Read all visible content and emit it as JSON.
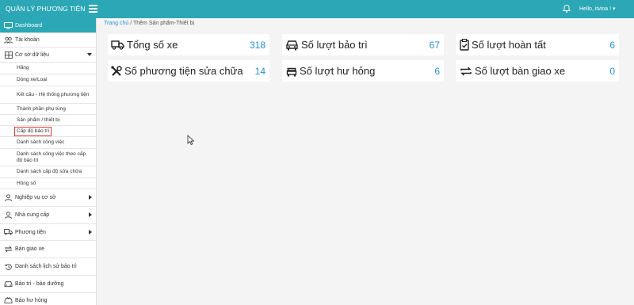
{
  "header": {
    "brand": "QUẢN LÝ PHƯƠNG TIỆN",
    "user_greeting": "Hello, itvina !",
    "user_caret": "▾"
  },
  "sidebar": {
    "dashboard": "Dashboard",
    "account": "Tài khoản",
    "database": "Cơ sở dữ liệu",
    "database_items": [
      "Hãng",
      "Dòng xe/Loại",
      "Kết cấu - Hệ thống phương tiện",
      "Thành phần phụ tùng",
      "Sản phẩm / thiết bị",
      "Cấp độ bảo trì",
      "Danh sách công việc",
      "Danh sách công việc theo cấp độ bảo trì",
      "Danh sách cấp độ sửa chữa",
      "Hồng số"
    ],
    "business": "Nghiệp vụ cơ sở",
    "supplier": "Nhà cung cấp",
    "vehicle": "Phương tiện",
    "handover": "Bàn giao xe",
    "history": "Danh sách lịch sử bảo trì",
    "maintenance": "Bảo trì - bảo dưỡng",
    "damage": "Báo hư hỏng"
  },
  "breadcrumb": {
    "home": "Trang chủ",
    "separator": "/",
    "current": "Thêm Sản phẩm-Thiết bị"
  },
  "cards": [
    {
      "icon": "truck-icon",
      "label": "Tổng số xe",
      "value": "318"
    },
    {
      "icon": "car-icon",
      "label": "Số lượt bảo trì",
      "value": "67"
    },
    {
      "icon": "clipboard-check-icon",
      "label": "Số lượt hoàn tất",
      "value": "6"
    },
    {
      "icon": "tools-icon",
      "label": "Số phương tiện sửa chữa",
      "value": "14"
    },
    {
      "icon": "car-crash-icon",
      "label": "Số lượt hư hỏng",
      "value": "6"
    },
    {
      "icon": "exchange-icon",
      "label": "Số lượt bàn giao xe",
      "value": "0"
    }
  ],
  "colors": {
    "accent": "#2ba7b5",
    "link": "#2a8fd0",
    "highlight_border": "#e03a3a"
  }
}
